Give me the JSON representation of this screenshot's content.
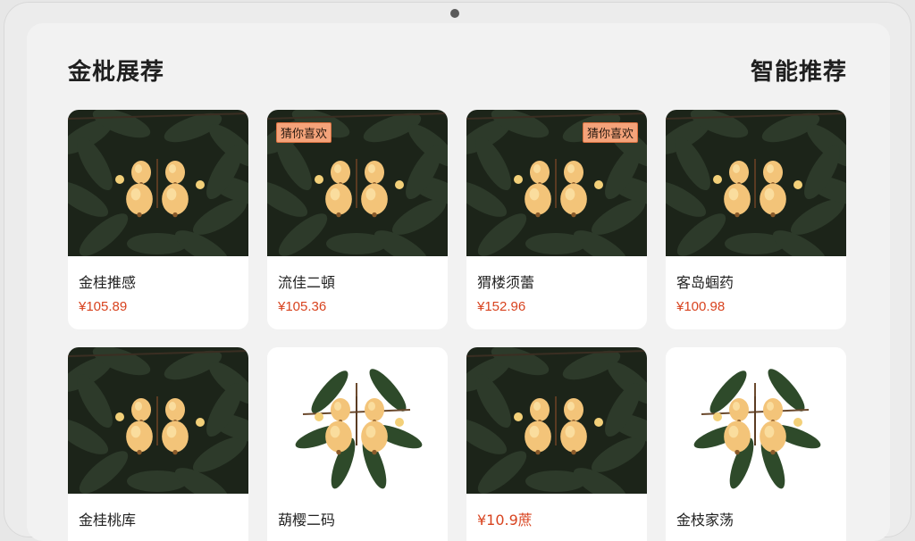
{
  "header": {
    "left_title": "金枇展荐",
    "right_title": "智能推荐"
  },
  "products": [
    {
      "name": "金桂推感",
      "price": "¥105.89",
      "badge": "",
      "photo": "dark"
    },
    {
      "name": "流佳二頓",
      "price": "¥105.36",
      "badge": "猜你喜欢",
      "photo": "dark"
    },
    {
      "name": "猬楼须蕾",
      "price": "¥152.96",
      "badge": "猜你喜欢",
      "photo": "dark"
    },
    {
      "name": "客岛蝈药",
      "price": "¥100.98",
      "badge": "",
      "photo": "dark"
    },
    {
      "name": "金桂桃库",
      "price": "",
      "badge": "",
      "photo": "dark"
    },
    {
      "name": "葫樱二码",
      "price": "",
      "badge": "",
      "photo": "light"
    },
    {
      "name": "¥10.9蔗",
      "price": "",
      "badge": "",
      "photo": "dark"
    },
    {
      "name": "金枝家荡",
      "price": "",
      "badge": "",
      "photo": "light"
    }
  ],
  "icons": {
    "fruit_photo": "loquat-photo-icon",
    "camera": "camera-dot-icon"
  },
  "colors": {
    "price": "#d8431f",
    "badge_bg": "#f4a37a",
    "card_bg": "#ffffff"
  }
}
